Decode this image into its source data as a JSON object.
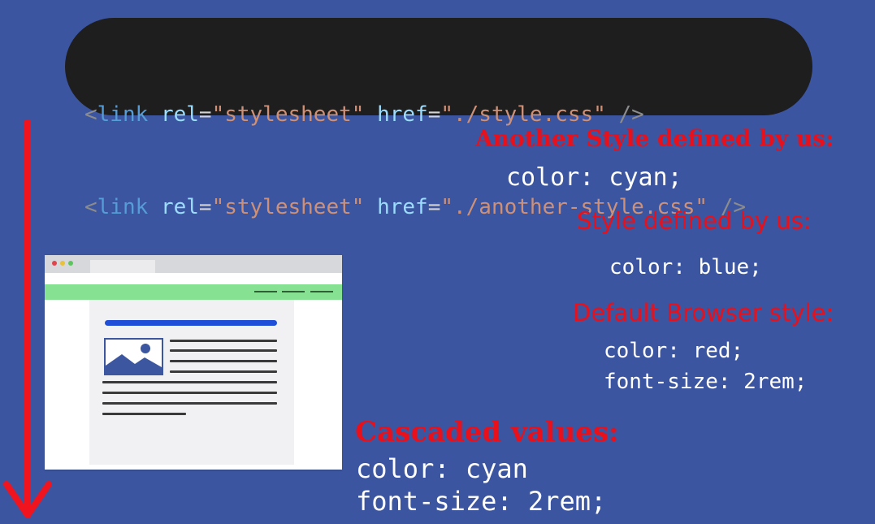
{
  "code": {
    "lines": [
      {
        "open": "<",
        "tag": "link",
        "attr1": "rel",
        "eq1": "=",
        "val1": "\"stylesheet\"",
        "attr2": "href",
        "eq2": "=",
        "val2": "\"./style.css\"",
        "close": "/>"
      },
      {
        "open": "<",
        "tag": "link",
        "attr1": "rel",
        "eq1": "=",
        "val1": "\"stylesheet\"",
        "attr2": "href",
        "eq2": "=",
        "val2": "\"./another-style.css\"",
        "close": "/>"
      }
    ]
  },
  "another_style": {
    "heading": "Another Style defined by us:",
    "rule": "color: cyan;"
  },
  "our_style": {
    "heading": "Style defined by us:",
    "rule": "color: blue;"
  },
  "default_style": {
    "heading": "Default Browser style:",
    "rule1": "color: red;",
    "rule2": "font-size: 2rem;"
  },
  "cascaded": {
    "heading": "Cascaded values:",
    "rule1": "color: cyan",
    "rule2": "font-size: 2rem;"
  },
  "colors": {
    "background": "#3b55a0",
    "code_bg": "#1e1e1e",
    "arrow": "#f0141e",
    "heading": "#e8101a",
    "browser_nav": "#86e292",
    "browser_accent": "#1f4fd8"
  },
  "icons": {
    "arrow": "down-arrow-icon",
    "illustration": "browser-window-illustration",
    "image": "image-placeholder-icon"
  }
}
